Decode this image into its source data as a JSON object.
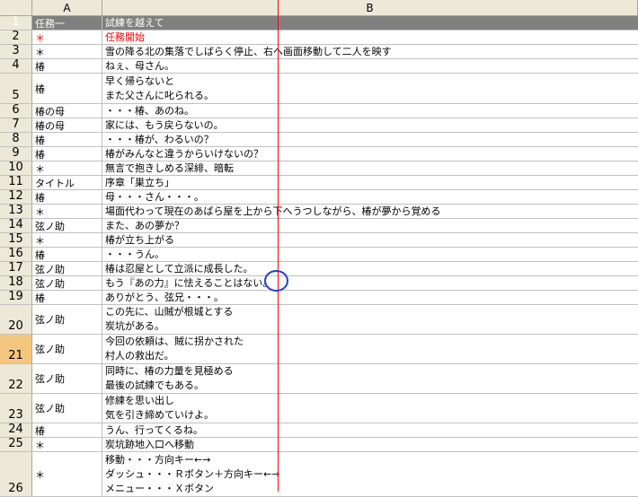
{
  "columns": {
    "a": "A",
    "b": "B"
  },
  "rows": [
    {
      "num": "1",
      "a": "任務一",
      "b": "試練を越えて",
      "style": "header",
      "h": 16
    },
    {
      "num": "2",
      "a": "＊",
      "b": "任務開始",
      "style": "red",
      "h": 16
    },
    {
      "num": "3",
      "a": "＊",
      "b": "雪の降る北の集落でしばらく停止、右へ画面移動して二人を映す",
      "h": 16
    },
    {
      "num": "4",
      "a": "椿",
      "b": "ねぇ、母さん。",
      "h": 16
    },
    {
      "num": "5",
      "a": "椿",
      "lines": [
        "早く帰らないと",
        "また父さんに叱られる。"
      ],
      "h": 34
    },
    {
      "num": "6",
      "a": "椿の母",
      "b": "・・・椿、あのね。",
      "h": 16
    },
    {
      "num": "7",
      "a": "椿の母",
      "b": "家には、もう戻らないの。",
      "h": 16
    },
    {
      "num": "8",
      "a": "椿",
      "b": "・・・椿が、わるいの？",
      "h": 16
    },
    {
      "num": "9",
      "a": "椿",
      "b": "椿がみんなと違うからいけないの？",
      "h": 16
    },
    {
      "num": "10",
      "a": "＊",
      "b": "無言で抱きしめる深緋、暗転",
      "h": 16
    },
    {
      "num": "11",
      "a": "タイトル",
      "b": "序章「巣立ち」",
      "h": 16
    },
    {
      "num": "12",
      "a": "椿",
      "b": "母・・・さん・・・。",
      "h": 16
    },
    {
      "num": "13",
      "a": "＊",
      "b": "場面代わって現在のあばら屋を上から下へうつしながら、椿が夢から覚める",
      "h": 16
    },
    {
      "num": "14",
      "a": "弦ノ助",
      "b": "また、あの夢か？",
      "h": 16
    },
    {
      "num": "15",
      "a": "＊",
      "b": "椿が立ち上がる",
      "h": 16
    },
    {
      "num": "16",
      "a": "椿",
      "b": "・・・うん。",
      "h": 16
    },
    {
      "num": "17",
      "a": "弦ノ助",
      "b": "椿は忍屋として立派に成長した。",
      "h": 16
    },
    {
      "num": "18",
      "a": "弦ノ助",
      "b": "もう『あの力』に怯えることはない。",
      "h": 16
    },
    {
      "num": "19",
      "a": "椿",
      "b": "ありがとう、弦兄・・・。",
      "h": 16
    },
    {
      "num": "20",
      "a": "弦ノ助",
      "lines": [
        "この先に、山賊が根城とする",
        "炭坑がある。"
      ],
      "h": 33
    },
    {
      "num": "21",
      "a": "弦ノ助",
      "lines": [
        "今回の依頼は、賊に拐かされた",
        "村人の救出だ。"
      ],
      "h": 33,
      "selected": true
    },
    {
      "num": "22",
      "a": "弦ノ助",
      "lines": [
        "同時に、椿の力量を見極める",
        "最後の試練でもある。"
      ],
      "h": 33
    },
    {
      "num": "23",
      "a": "弦ノ助",
      "lines": [
        "修練を思い出し",
        "気を引き締めていけよ。"
      ],
      "h": 33
    },
    {
      "num": "24",
      "a": "椿",
      "b": "うん、行ってくるね。",
      "h": 16
    },
    {
      "num": "25",
      "a": "＊",
      "b": "炭坑跡地入口へ移動",
      "h": 16
    },
    {
      "num": "26",
      "a": "＊",
      "lines": [
        "移動・・・方向キー←→",
        "ダッシュ・・・Ｒボタン＋方向キー←→",
        "メニュー・・・Ｘボタン"
      ],
      "h": 50
    }
  ]
}
